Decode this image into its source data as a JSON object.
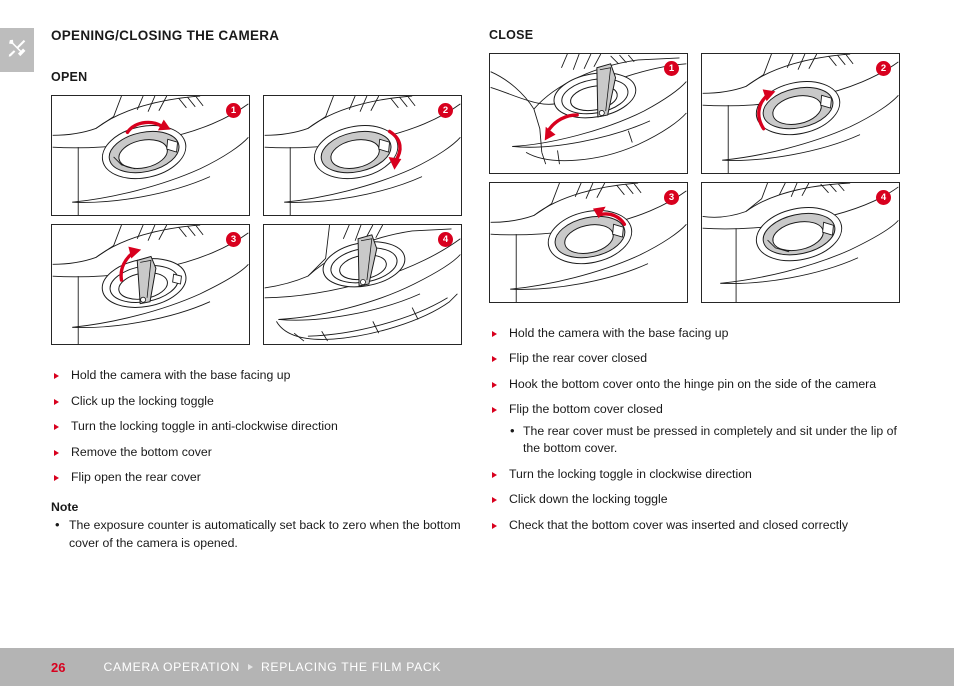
{
  "chapter_tab": {
    "icon": "tools-icon"
  },
  "left_column": {
    "section_title": "OPENING/CLOSING THE CAMERA",
    "sub_title": "OPEN",
    "figures": [
      {
        "badge": "1",
        "caption": "camera base with locking toggle, clockwise red arrow above toggle"
      },
      {
        "badge": "2",
        "caption": "locking toggle with red arrow curving down at right side"
      },
      {
        "badge": "3",
        "caption": "locking toggle flipped up with red arrow pointing up"
      },
      {
        "badge": "4",
        "caption": "bottom cover removed from camera body"
      }
    ],
    "steps": [
      "Hold the camera with the base facing up",
      "Click up the locking toggle",
      "Turn the locking toggle in anti-clockwise direction",
      "Remove the bottom cover",
      "Flip open the rear cover"
    ],
    "note_heading": "Note",
    "notes": [
      "The exposure counter is automatically set back to zero when the bottom cover of the camera is opened."
    ]
  },
  "right_column": {
    "sub_title": "CLOSE",
    "figures": [
      {
        "badge": "1",
        "caption": "rear cover being flipped closed, red arrow pointing down-left"
      },
      {
        "badge": "2",
        "caption": "locking toggle with red arrow curving up at left side"
      },
      {
        "badge": "3",
        "caption": "locking toggle with red arrow pointing up-left"
      },
      {
        "badge": "4",
        "caption": "locking toggle seated flush, cover closed"
      }
    ],
    "steps": [
      {
        "text": "Hold the camera with the base facing up",
        "sub": []
      },
      {
        "text": "Flip the rear cover closed",
        "sub": []
      },
      {
        "text": "Hook the bottom cover onto the hinge pin on the side of the camera",
        "sub": []
      },
      {
        "text": "Flip the bottom cover closed",
        "sub": [
          "The rear cover must be pressed in completely and sit under the lip of the bottom cover."
        ]
      },
      {
        "text": "Turn the locking toggle in clockwise direction",
        "sub": []
      },
      {
        "text": "Click down the locking toggle",
        "sub": []
      },
      {
        "text": "Check that the bottom cover was inserted and closed correctly",
        "sub": []
      }
    ]
  },
  "footer": {
    "page_number": "26",
    "breadcrumb_primary": "CAMERA OPERATION",
    "breadcrumb_secondary": "REPLACING THE FILM PACK"
  },
  "colors": {
    "accent_red": "#d8001e",
    "footer_grey": "#b4b4b4",
    "tab_grey": "#bdbdbd",
    "toggle_fill": "#c9c9c9"
  }
}
